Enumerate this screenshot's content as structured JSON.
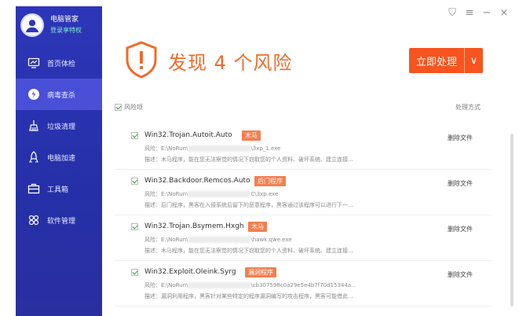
{
  "app": {
    "name": "电脑管家",
    "login_text": "登录享特权"
  },
  "nav": [
    {
      "label": "首页体检",
      "icon": "monitor-icon"
    },
    {
      "label": "病毒查杀",
      "icon": "shield-scan-icon",
      "active": true
    },
    {
      "label": "垃圾清理",
      "icon": "broom-icon"
    },
    {
      "label": "电脑加速",
      "icon": "rocket-icon"
    },
    {
      "label": "工具箱",
      "icon": "toolbox-icon"
    },
    {
      "label": "软件管理",
      "icon": "apps-icon"
    }
  ],
  "window": {
    "skin": "⛉",
    "menu": "≡",
    "minimize": "−",
    "close": "×"
  },
  "header": {
    "headline": "发现 4 个风险",
    "action_label": "立即处理",
    "caret": "∨"
  },
  "columns": {
    "risk": "风险项",
    "method": "处理方式"
  },
  "risks": [
    {
      "name": "Win32.Trojan.Autoit.Auto",
      "tag": "木马",
      "tag_color": "#f47f4f",
      "path_prefix": "风险：E:\\NoRun\\",
      "path_suffix": "\\3xp_1.exe",
      "desc": "描述：木马程序，能在您无法察觉的情况下窃取您的个人资料、破坏系统、建立连接...",
      "action": "删除文件"
    },
    {
      "name": "Win32.Backdoor.Remcos.Auto",
      "tag": "后门程序",
      "tag_color": "#f47f4f",
      "path_prefix": "风险：E:\\NoRun\\",
      "path_suffix": "C\\3xp.exe",
      "desc": "描述：后门程序，黑客在入侵系统后留下的恶意程序，黑客通过该程序可以进行下一...",
      "action": "删除文件"
    },
    {
      "name": "Win32.Trojan.Bsymem.Hxgh",
      "tag": "木马",
      "tag_color": "#f47f4f",
      "path_prefix": "风险：E:\\NoRun\\",
      "path_suffix": "\\hawk.qwe.exe",
      "desc": "描述：木马程序，能在您无法察觉的情况下窃取您的个人资料、破坏系统、建立连接...",
      "action": "删除文件"
    },
    {
      "name": "Win32.Exploit.Oleink.Syrg",
      "tag": "漏洞程序",
      "tag_color": "#f47f4f",
      "path_prefix": "风险：E:\\NoRun\\",
      "path_suffix": "\\cb307598c0a29e5e4b7f70d15344a...",
      "desc": "描述：漏洞利用程序，黑客针对某些特定的程序漏洞编写的攻击程序，黑客可能借此...",
      "action": "删除文件"
    }
  ]
}
